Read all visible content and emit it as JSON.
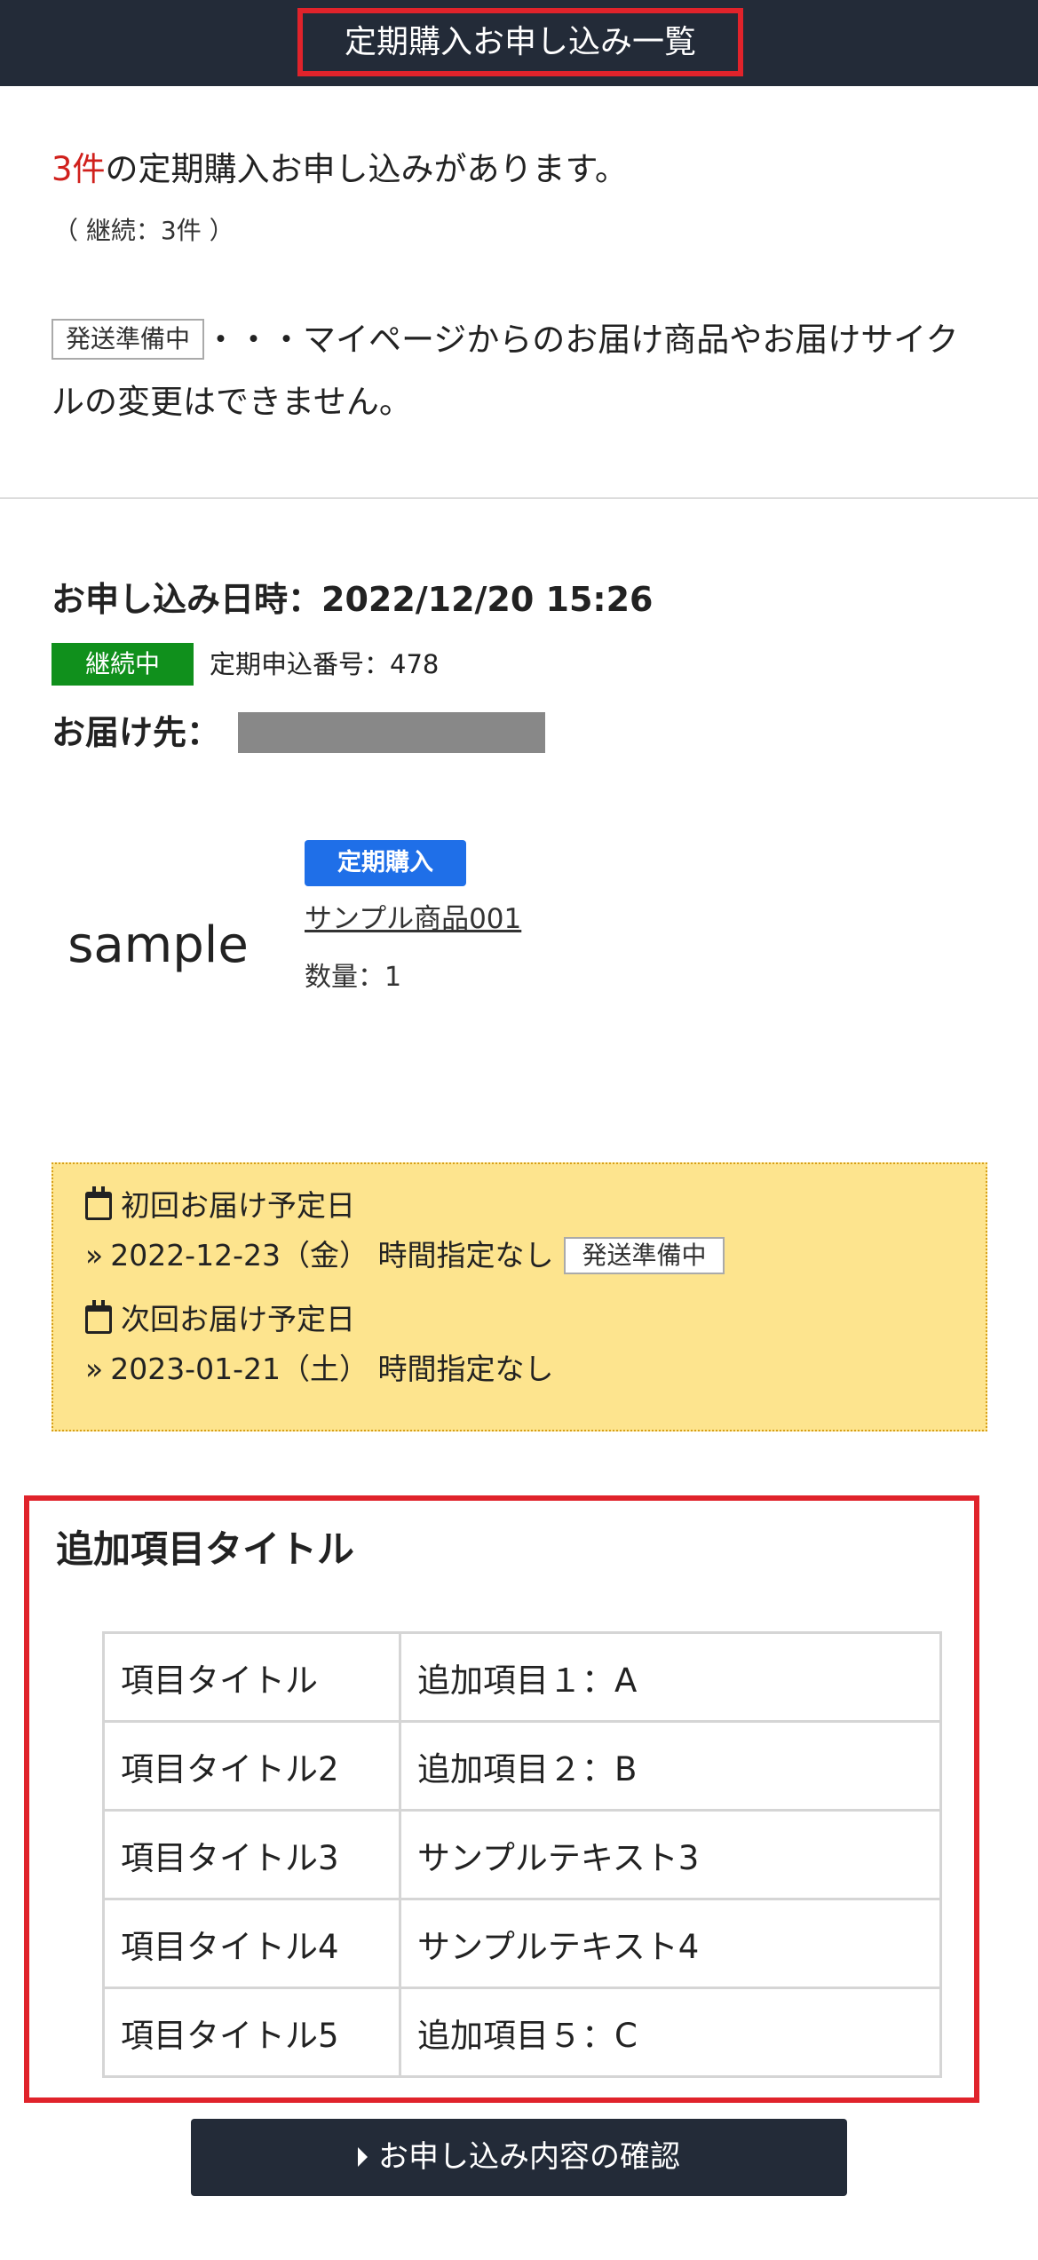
{
  "header": {
    "title": "定期購入お申し込み一覧"
  },
  "intro": {
    "count": "3件",
    "text": "の定期購入お申し込みがあります。",
    "sub": "（ 継続：3件 ）"
  },
  "notice": {
    "tag": "発送準備中",
    "text": "・・・マイページからのお届け商品やお届けサイクルの変更はできません。"
  },
  "order": {
    "date_label": "お申し込み日時：2022/12/20 15:26",
    "status": "継続中",
    "number": "定期申込番号：478",
    "destination_label": "お届け先："
  },
  "product": {
    "image_text": "sample",
    "type_badge": "定期購入",
    "name": "サンプル商品001",
    "quantity": "数量：1"
  },
  "delivery": {
    "first_label": "初回お届け予定日",
    "first_value": "2022-12-23（金） 時間指定なし",
    "first_tag": "発送準備中",
    "next_label": "次回お届け予定日",
    "next_value": "2023-01-21（土） 時間指定なし",
    "sep": "»"
  },
  "extra": {
    "title": "追加項目タイトル",
    "rows": [
      {
        "key": "項目タイトル",
        "value": "追加項目１：A"
      },
      {
        "key": "項目タイトル2",
        "value": "追加項目２：B"
      },
      {
        "key": "項目タイトル3",
        "value": "サンプルテキスト3"
      },
      {
        "key": "項目タイトル4",
        "value": "サンプルテキスト4"
      },
      {
        "key": "項目タイトル5",
        "value": "追加項目５：C"
      }
    ]
  },
  "confirm_button": {
    "label": "お申し込み内容の確認"
  },
  "colors": {
    "header_bg": "#232b38",
    "highlight": "#e0232b",
    "status_green": "#10901c",
    "badge_blue": "#1f6fe8",
    "delivery_bg": "#fde48e"
  }
}
